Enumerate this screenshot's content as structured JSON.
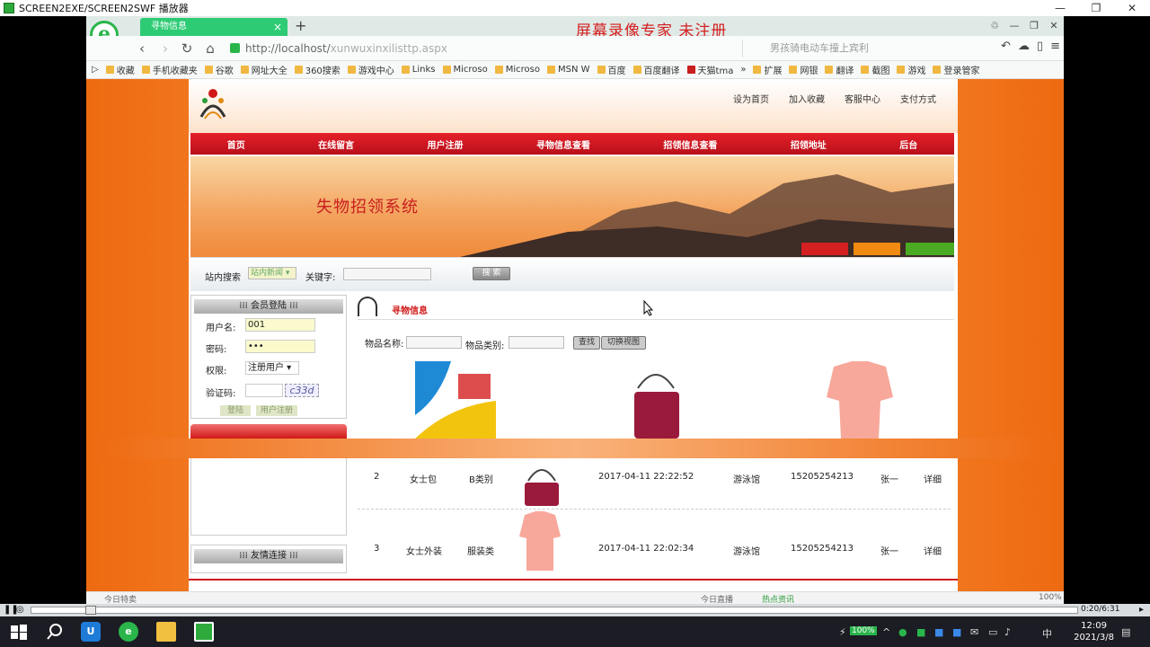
{
  "player": {
    "title": "SCREEN2EXE/SCREEN2SWF 播放器",
    "time": "0:20/6:31"
  },
  "browser": {
    "tab_title": "寻物信息",
    "watermark": "屏幕录像专家  未注册",
    "url_host": "http://localhost/",
    "url_path": "xunwuxinxilisttp.aspx",
    "search_placeholder": "男孩骑电动车撞上宾利",
    "bookmarks": [
      "收藏",
      "手机收藏夹",
      "谷歌",
      "网址大全",
      "360搜索",
      "游戏中心",
      "Links",
      "Microso",
      "Microso",
      "MSN W",
      "百度",
      "百度翻译",
      "天猫tma",
      "扩展",
      "网银",
      "翻译",
      "截图",
      "游戏",
      "登录管家"
    ]
  },
  "site": {
    "toplinks": [
      "设为首页",
      "加入收藏",
      "客服中心",
      "支付方式"
    ],
    "menu": [
      "首页",
      "在线留言",
      "用户注册",
      "寻物信息查看",
      "招领信息查看",
      "招领地址",
      "后台"
    ],
    "banner_title": "失物招领系统",
    "search": {
      "label": "站内搜索",
      "select_value": "站内新闻",
      "keyword_label": "关键字:",
      "button": "搜 索"
    },
    "login": {
      "title": "会员登陆",
      "username_label": "用户名:",
      "username_value": "001",
      "password_label": "密码:",
      "password_value": "•••",
      "role_label": "权限:",
      "role_value": "注册用户",
      "captcha_label": "验证码:",
      "captcha_text": "c33d",
      "login_button": "登陆",
      "register_button": "用户注册"
    },
    "links_title": "友情连接",
    "content_title": "寻物信息",
    "filter": {
      "name_label": "物品名称:",
      "type_label": "物品类别:",
      "search_button": "查找",
      "switch_button": "切换视图"
    },
    "rows": [
      {
        "no": "2",
        "name": "女士包",
        "type": "B类别",
        "time": "2017-04-11 22:22:52",
        "place": "游泳馆",
        "phone": "15205254213",
        "person": "张一",
        "detail": "详细"
      },
      {
        "no": "3",
        "name": "女士外装",
        "type": "服装类",
        "time": "2017-04-11 22:02:34",
        "place": "游泳馆",
        "phone": "15205254213",
        "person": "张一",
        "detail": "详细"
      }
    ]
  },
  "statusbar": {
    "left": "今日特卖",
    "mid1": "今日直播",
    "mid2": "热点资讯",
    "zoom": "100%"
  },
  "taskbar": {
    "battery": "100%",
    "ime": "中",
    "clock_time": "12:09",
    "clock_date": "2021/3/8"
  }
}
